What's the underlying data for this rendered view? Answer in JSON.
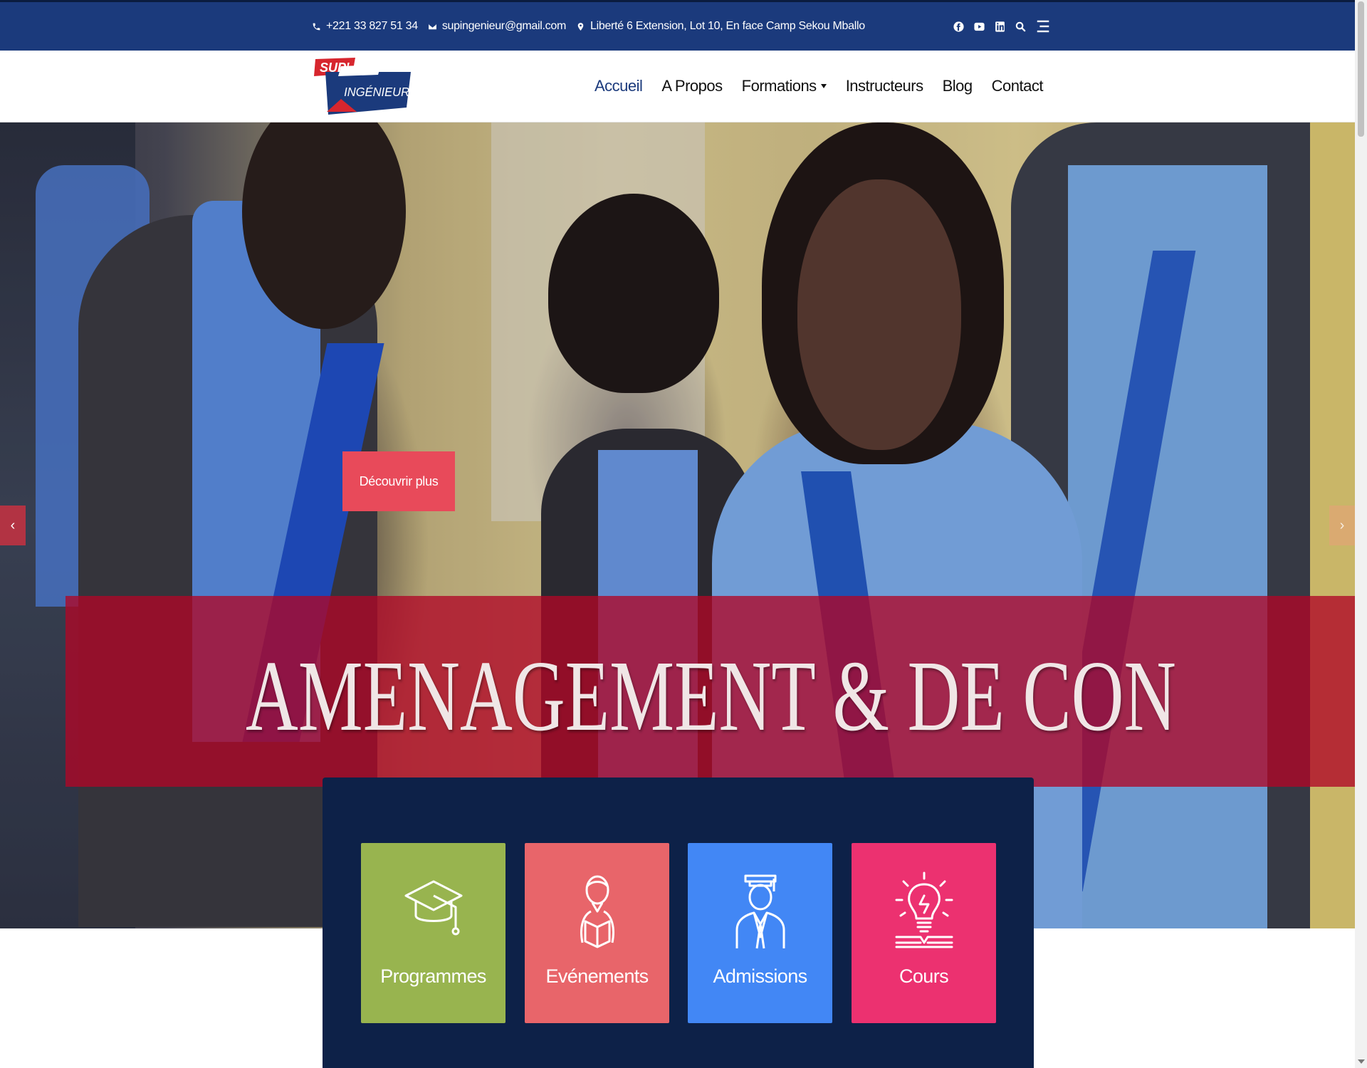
{
  "topbar": {
    "phone": "+221 33 827 51 34",
    "email": "supingenieur@gmail.com",
    "address": "Liberté 6 Extension, Lot 10, En face Camp Sekou Mballo",
    "icons": [
      "phone-icon",
      "envelope-icon",
      "map-marker-icon",
      "facebook-icon",
      "youtube-icon",
      "linkedin-icon",
      "search-icon",
      "menu-icon"
    ]
  },
  "logo": {
    "line1": "SUP'",
    "line2": "INGÉNIEUR"
  },
  "nav": {
    "items": [
      {
        "label": "Accueil",
        "active": true
      },
      {
        "label": "A Propos"
      },
      {
        "label": "Formations",
        "has_dropdown": true
      },
      {
        "label": "Instructeurs"
      },
      {
        "label": "Blog"
      },
      {
        "label": "Contact"
      }
    ]
  },
  "hero": {
    "cta_label": "Découvrir plus",
    "title": "INSTITUT D'AMENAGEMENT & DE CONSTRUCTION",
    "prev_arrow": "‹",
    "next_arrow": "›"
  },
  "features": {
    "cards": [
      {
        "label": "Programmes",
        "color": "#98b44f",
        "icon": "graduation-cap-icon"
      },
      {
        "label": "Evénements",
        "color": "#e8656a",
        "icon": "student-reading-icon"
      },
      {
        "label": "Admissions",
        "color": "#4287f5",
        "icon": "graduate-icon"
      },
      {
        "label": "Cours",
        "color": "#ec3170",
        "icon": "lightbulb-book-icon"
      }
    ]
  },
  "colors": {
    "topbar": "#1b3a7c",
    "nav_active": "#1b3a7c",
    "cta": "#e84a5a",
    "banner": "#b00626",
    "panel": "#0d2148"
  }
}
